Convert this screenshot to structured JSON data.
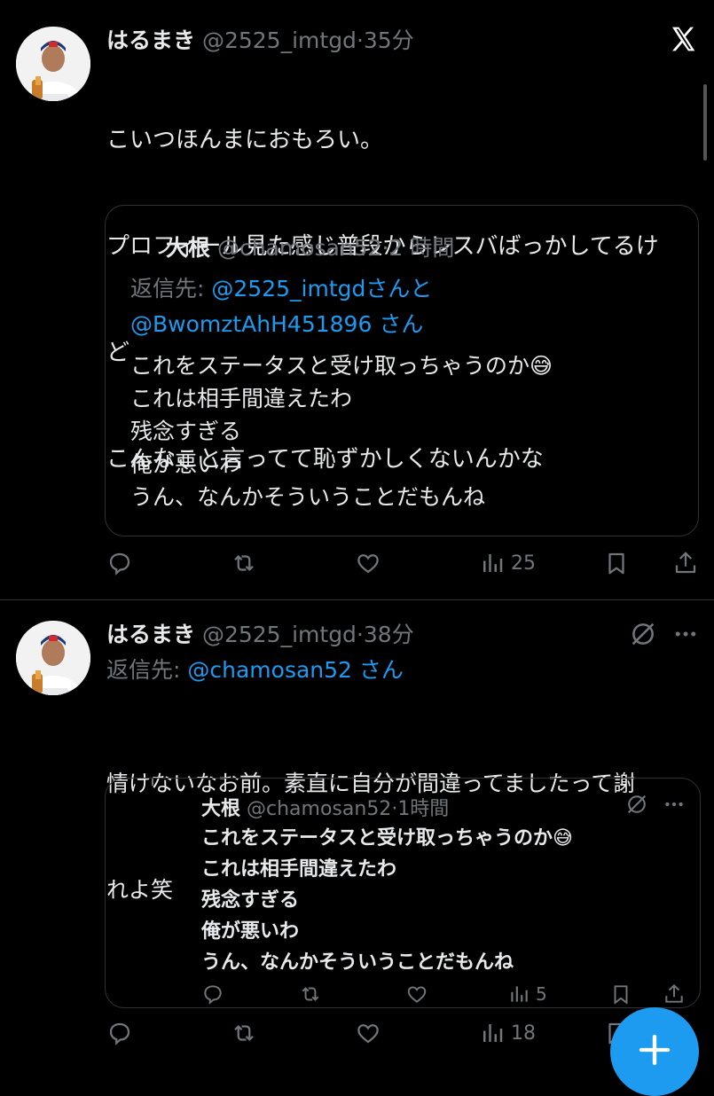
{
  "tweet1": {
    "name": "はるまき",
    "handle": "@2525_imtgd",
    "time": "35分",
    "lines": [
      "こいつほんまにおもろい。",
      "プロフィール見た感じ普段からレスバばっかしてるけ",
      "ど",
      "こんなこと言ってて恥ずかしくないんかな"
    ],
    "quote": {
      "name": "大根",
      "handle": "@chamosan52",
      "time": "2 時間",
      "reply_prefix": "返信先:",
      "reply_to_1": "@2525_imtgd",
      "reply_mid": "さんと",
      "reply_to_2": "@BwomztAhH451896",
      "reply_suffix": "さん",
      "lines": [
        "これをステータスと受け取っちゃうのか😅",
        "これは相手間違えたわ",
        "残念すぎる",
        "俺が悪いわ",
        "うん、なんかそういうことだもんね"
      ]
    },
    "views": "25"
  },
  "tweet2": {
    "name": "はるまき",
    "handle": "@2525_imtgd",
    "time": "38分",
    "reply_prefix": "返信先:",
    "reply_to": "@chamosan52",
    "reply_suffix": "さん",
    "lines": [
      "情けないなお前。素直に自分が間違ってましたって謝",
      "れよ笑"
    ],
    "quote": {
      "name": "大根",
      "handle": "@chamosan52",
      "time": "1時間",
      "lines": [
        "これをステータスと受け取っちゃうのか😅",
        "これは相手間違えたわ",
        "残念すぎる",
        "俺が悪いわ",
        "うん、なんかそういうことだもんね"
      ],
      "views": "5"
    },
    "views": "18"
  },
  "colors": {
    "background": "#000000",
    "text": "#e7e9ea",
    "muted": "#71767b",
    "accent": "#1d9bf0",
    "border": "#2f3336"
  },
  "icons": [
    "x-logo",
    "reply-icon",
    "retweet-icon",
    "like-icon",
    "views-icon",
    "bookmark-icon",
    "share-icon",
    "more-icon",
    "grok-icon",
    "compose-icon"
  ]
}
